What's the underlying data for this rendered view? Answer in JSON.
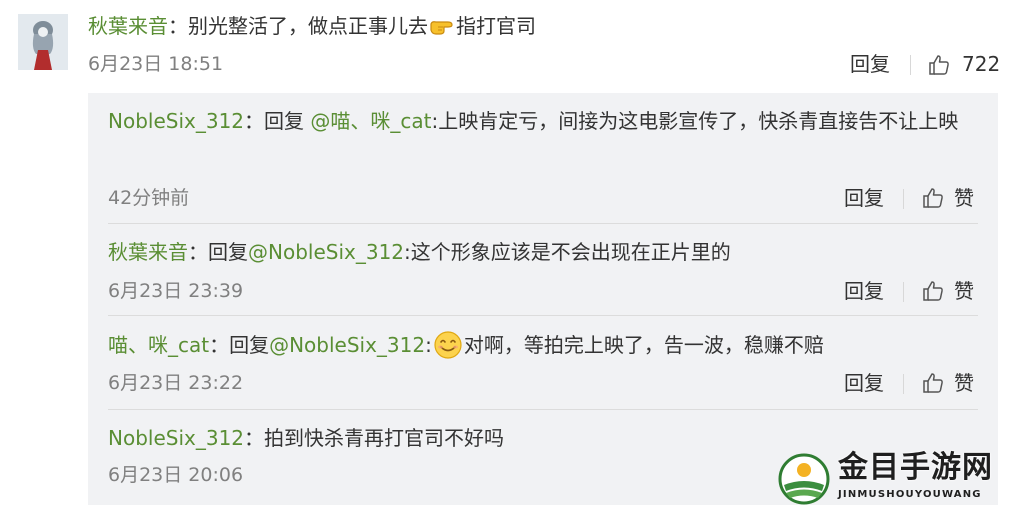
{
  "comment": {
    "username": "秋葉来音",
    "text_before_emoji": "别光整活了，做点正事儿去",
    "emoji": "hand-pointing-icon",
    "text_after_emoji": "指打官司",
    "time": "6月23日 18:51",
    "reply_label": "回复",
    "like_count": "722"
  },
  "replies": [
    {
      "username": "NobleSix_312",
      "reply_word": "回复",
      "mention": "@喵、咪_cat",
      "text": ":上映肯定亏，间接为这电影宣传了，快杀青直接告不让上映",
      "time": "42分钟前",
      "reply_label": "回复",
      "like_label": "赞"
    },
    {
      "username": "秋葉来音",
      "reply_word": "回复",
      "mention": "@NobleSix_312",
      "text": ":这个形象应该是不会出现在正片里的",
      "time": "6月23日 23:39",
      "reply_label": "回复",
      "like_label": "赞"
    },
    {
      "username": "喵、咪_cat",
      "reply_word": "回复",
      "mention": "@NobleSix_312",
      "text_before_emoji": ":",
      "emoji": "smile-emoji-icon",
      "text": "对啊，等拍完上映了，告一波，稳赚不赔",
      "time": "6月23日 23:22",
      "reply_label": "回复",
      "like_label": "赞"
    },
    {
      "username": "NobleSix_312",
      "text": "拍到快杀青再打官司不好吗",
      "time": "6月23日 20:06"
    }
  ],
  "watermark": {
    "cn": "金目手游网",
    "en": "JINMUSHOUYOUWANG"
  },
  "colors": {
    "username": "#5a8e34",
    "timestamp": "#808080",
    "reply_bg": "#f1f2f4"
  }
}
